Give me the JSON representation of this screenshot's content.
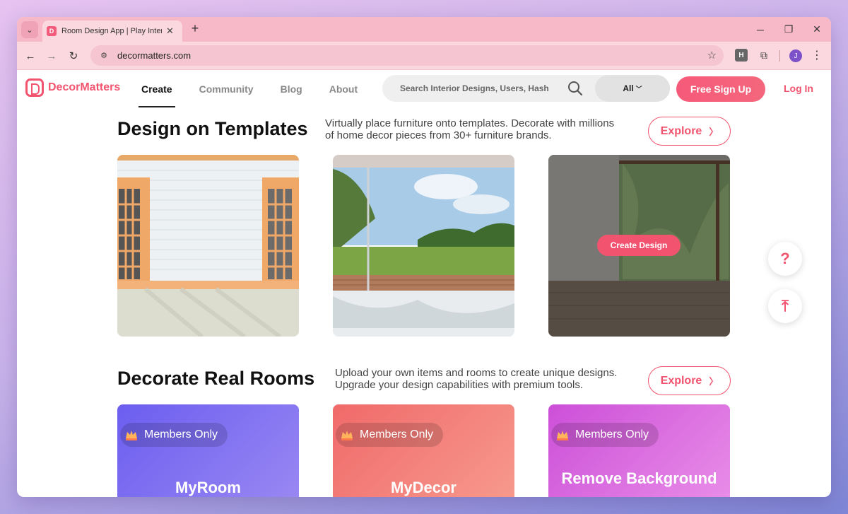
{
  "browser": {
    "tab_title": "Room Design App | Play Interior",
    "tab_close": "✕",
    "new_tab": "+",
    "url": "decormatters.com",
    "avatar_initial": "J",
    "extension_h": "H",
    "win_minimize": "─",
    "win_restore": "❐",
    "win_close": "✕"
  },
  "header": {
    "logo_text": "DecorMatters",
    "nav": [
      {
        "label": "Create",
        "active": true
      },
      {
        "label": "Community",
        "active": false
      },
      {
        "label": "Blog",
        "active": false
      },
      {
        "label": "About",
        "active": false
      }
    ],
    "search_placeholder": "Search Interior Designs, Users, Hash",
    "search_filter": "All",
    "signup_label": "Free Sign Up",
    "login_label": "Log In"
  },
  "templates_section": {
    "title": "Design on Templates",
    "description_line1": "Virtually place furniture onto templates. Decorate with millions",
    "description_line2": "of home decor pieces from 30+ furniture brands.",
    "explore_label": "Explore",
    "create_design_label": "Create Design"
  },
  "real_rooms_section": {
    "title": "Decorate Real Rooms",
    "description_line1": "Upload your own items and rooms to create unique designs.",
    "description_line2": "Upgrade your design capabilities with premium tools.",
    "explore_label": "Explore",
    "cards": [
      {
        "badge": "Members Only",
        "title": "MyRoom",
        "color": "#7b6cf0"
      },
      {
        "badge": "Members Only",
        "title": "MyDecor",
        "color": "#f47a7a"
      },
      {
        "badge": "Members Only",
        "title": "Remove Background",
        "color": "#d86ae0"
      }
    ]
  },
  "floating": {
    "help_label": "?",
    "top_label": "⤒"
  },
  "colors": {
    "brand": "#f2546f",
    "chrome_tab": "#f7b8c8"
  }
}
